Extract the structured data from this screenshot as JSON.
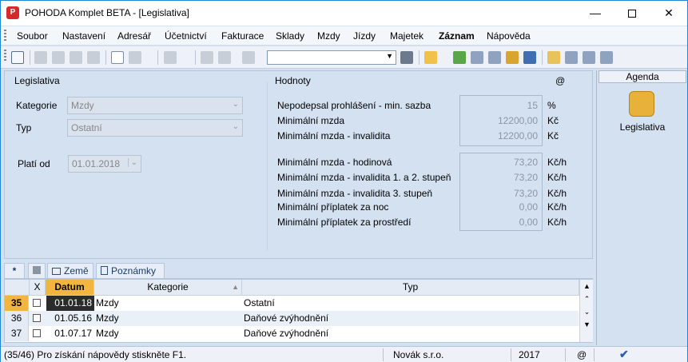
{
  "window": {
    "app_icon": "pohoda-app-icon",
    "title": "POHODA Komplet BETA - [Legislativa]",
    "controls": [
      "minimize-icon",
      "maximize-icon",
      "close-icon"
    ]
  },
  "menu": [
    "Soubor",
    "Nastavení",
    "Adresář",
    "Účetnictví",
    "Fakturace",
    "Sklady",
    "Mzdy",
    "Jízdy",
    "Majetek",
    "Záznam",
    "Nápověda"
  ],
  "form": {
    "section_left": "Legislativa",
    "kategorie_label": "Kategorie",
    "kategorie_value": "Mzdy",
    "typ_label": "Typ",
    "typ_value": "Ostatní",
    "plati_od_label": "Platí od",
    "plati_od_value": "01.01.2018",
    "section_right": "Hodnoty",
    "at_sign": "@",
    "values_group1": [
      {
        "label": "Nepodepsal prohlášení - min. sazba",
        "value": "15",
        "unit": "%"
      },
      {
        "label": "Minimální mzda",
        "value": "12200,00",
        "unit": "Kč"
      },
      {
        "label": "Minimální mzda - invalidita",
        "value": "12200,00",
        "unit": "Kč"
      }
    ],
    "values_group2": [
      {
        "label": "Minimální mzda - hodinová",
        "value": "73,20",
        "unit": "Kč/h"
      },
      {
        "label": "Minimální mzda - invalidita 1. a 2. stupeň",
        "value": "73,20",
        "unit": "Kč/h"
      },
      {
        "label": "Minimální mzda - invalidita 3. stupeň",
        "value": "73,20",
        "unit": "Kč/h"
      },
      {
        "label": "Minimální příplatek za noc",
        "value": "0,00",
        "unit": "Kč/h"
      },
      {
        "label": "Minimální příplatek za prostředí",
        "value": "0,00",
        "unit": "Kč/h"
      }
    ]
  },
  "tabs": {
    "star": "*",
    "zeme": "Země",
    "poznamky": "Poznámky"
  },
  "table": {
    "headers": {
      "x": "X",
      "datum": "Datum",
      "kategorie": "Kategorie",
      "typ": "Typ"
    },
    "rows": [
      {
        "num": "35",
        "datum": "01.01.18",
        "kategorie": "Mzdy",
        "typ": "Ostatní"
      },
      {
        "num": "36",
        "datum": "01.05.16",
        "kategorie": "Mzdy",
        "typ": "Daňové zvýhodnění"
      },
      {
        "num": "37",
        "datum": "01.07.17",
        "kategorie": "Mzdy",
        "typ": "Daňové zvýhodnění"
      }
    ]
  },
  "agenda": {
    "header": "Agenda",
    "item_label": "Legislativa"
  },
  "status": {
    "help": "(35/46) Pro získání nápovědy stiskněte F1.",
    "company": "Novák s.r.o.",
    "year": "2017",
    "at": "@"
  },
  "colors": {
    "accent": "#1e86d4",
    "panel": "#d4e1f1",
    "selected_row": "#ffd27a",
    "datum_header": "#f2b640",
    "selected_cell": "#2b2b2b"
  }
}
